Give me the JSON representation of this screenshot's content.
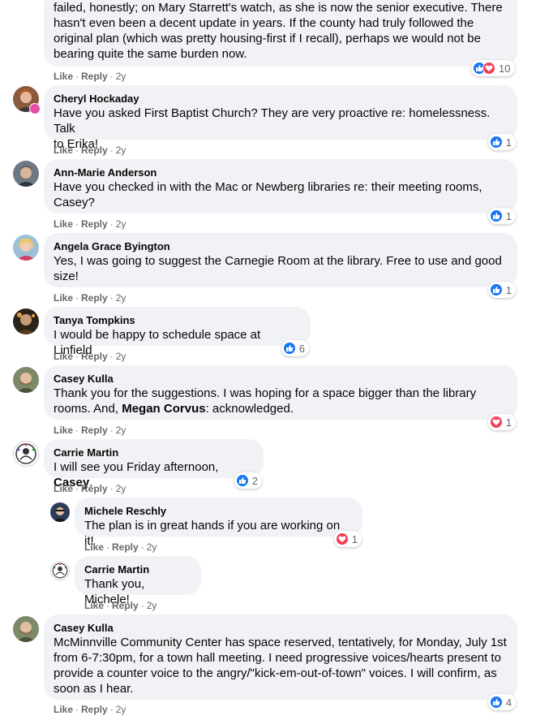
{
  "actions": {
    "like": "Like",
    "reply": "Reply",
    "dot": "·",
    "time": "2y"
  },
  "icons": {
    "like": "like-reaction-icon",
    "love": "love-reaction-icon"
  },
  "colors": {
    "like": "#1877f2",
    "love": "#f33e58",
    "bubble": "#f0f2f5",
    "meta": "#65676b"
  },
  "comments": [
    {
      "name": "",
      "lines": [
        "failed, honestly; on Mary Starrett's watch, as she is now the senior executive. There",
        "hasn't even been a decent update in years. If the county had truly followed the",
        "original plan (which was pretty housing-first if I recall), perhaps we would not be",
        "bearing quite the same burden now."
      ],
      "reactions": "10"
    },
    {
      "name": "Cheryl Hockaday",
      "lines": [
        "Have you asked First Baptist Church? They are very proactive re: homelessness. Talk",
        "to Erika!"
      ],
      "reactions": "1"
    },
    {
      "name": "Ann-Marie Anderson",
      "lines": [
        "Have you checked in with the Mac or Newberg libraries re: their meeting rooms,",
        "Casey?"
      ],
      "reactions": "1"
    },
    {
      "name": "Angela Grace Byington",
      "lines": [
        "Yes, I was going to suggest the Carnegie Room at the library. Free to use and good",
        "size!"
      ],
      "reactions": "1"
    },
    {
      "name": "Tanya Tompkins",
      "lines": [
        "I would be happy to schedule space at Linfield"
      ],
      "reactions": "6"
    },
    {
      "name": "Casey Kulla",
      "line1": "Thank you for the suggestions. I was hoping for a space bigger than the library",
      "line2_pre": "rooms. And, ",
      "line2_mention": "Megan Corvus",
      "line2_post": ": acknowledged.",
      "reactions": "1"
    },
    {
      "name": "Carrie Martin",
      "text_pre": "I will see you Friday afternoon, ",
      "mention": "Casey",
      "text_post": ".",
      "reactions": "2"
    },
    {
      "name": "Michele Reschly",
      "lines": [
        "The plan is in great hands if you are working on it!"
      ],
      "reactions": "1"
    },
    {
      "name": "Carrie Martin",
      "lines": [
        "Thank you, Michele!"
      ],
      "reactions": ""
    },
    {
      "name": "Casey Kulla",
      "lines": [
        "McMinnville Community Center has space reserved, tentatively, for Monday, July 1st",
        "from 6-7:30pm, for a town hall meeting. I need progressive voices/hearts present to",
        "provide a counter voice to the angry/\"kick-em-out-of-town\" voices. I will confirm, as",
        "soon as I hear."
      ],
      "reactions": "4"
    }
  ]
}
